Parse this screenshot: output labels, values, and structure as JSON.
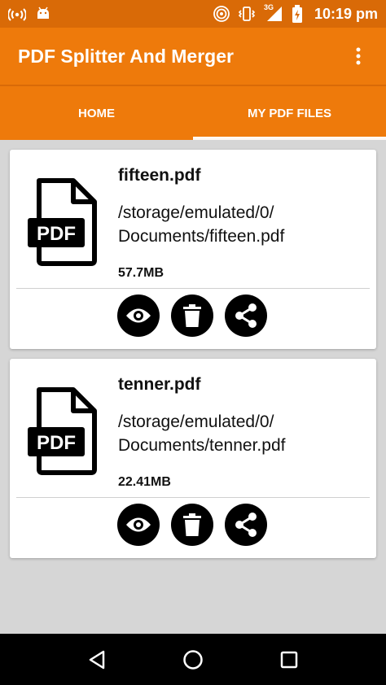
{
  "status_bar": {
    "time": "10:19 pm",
    "network": "3G"
  },
  "app_bar": {
    "title": "PDF Splitter And Merger",
    "overflow_icon": "more-vert-icon"
  },
  "tabs": [
    {
      "label": "HOME",
      "active": false
    },
    {
      "label": "MY PDF FILES",
      "active": true
    }
  ],
  "files": [
    {
      "name": "fifteen.pdf",
      "path": "/storage/emulated/0/\nDocuments/fifteen.pdf",
      "size": "57.7MB",
      "icon_label": "PDF"
    },
    {
      "name": "tenner.pdf",
      "path": "/storage/emulated/0/\nDocuments/tenner.pdf",
      "size": "22.41MB",
      "icon_label": "PDF"
    }
  ],
  "actions": [
    "view-icon",
    "delete-icon",
    "share-icon"
  ],
  "colors": {
    "status_bar": "#d96a07",
    "app_bar": "#ee7a0b",
    "background": "#d6d6d6",
    "action_button": "#000000"
  }
}
